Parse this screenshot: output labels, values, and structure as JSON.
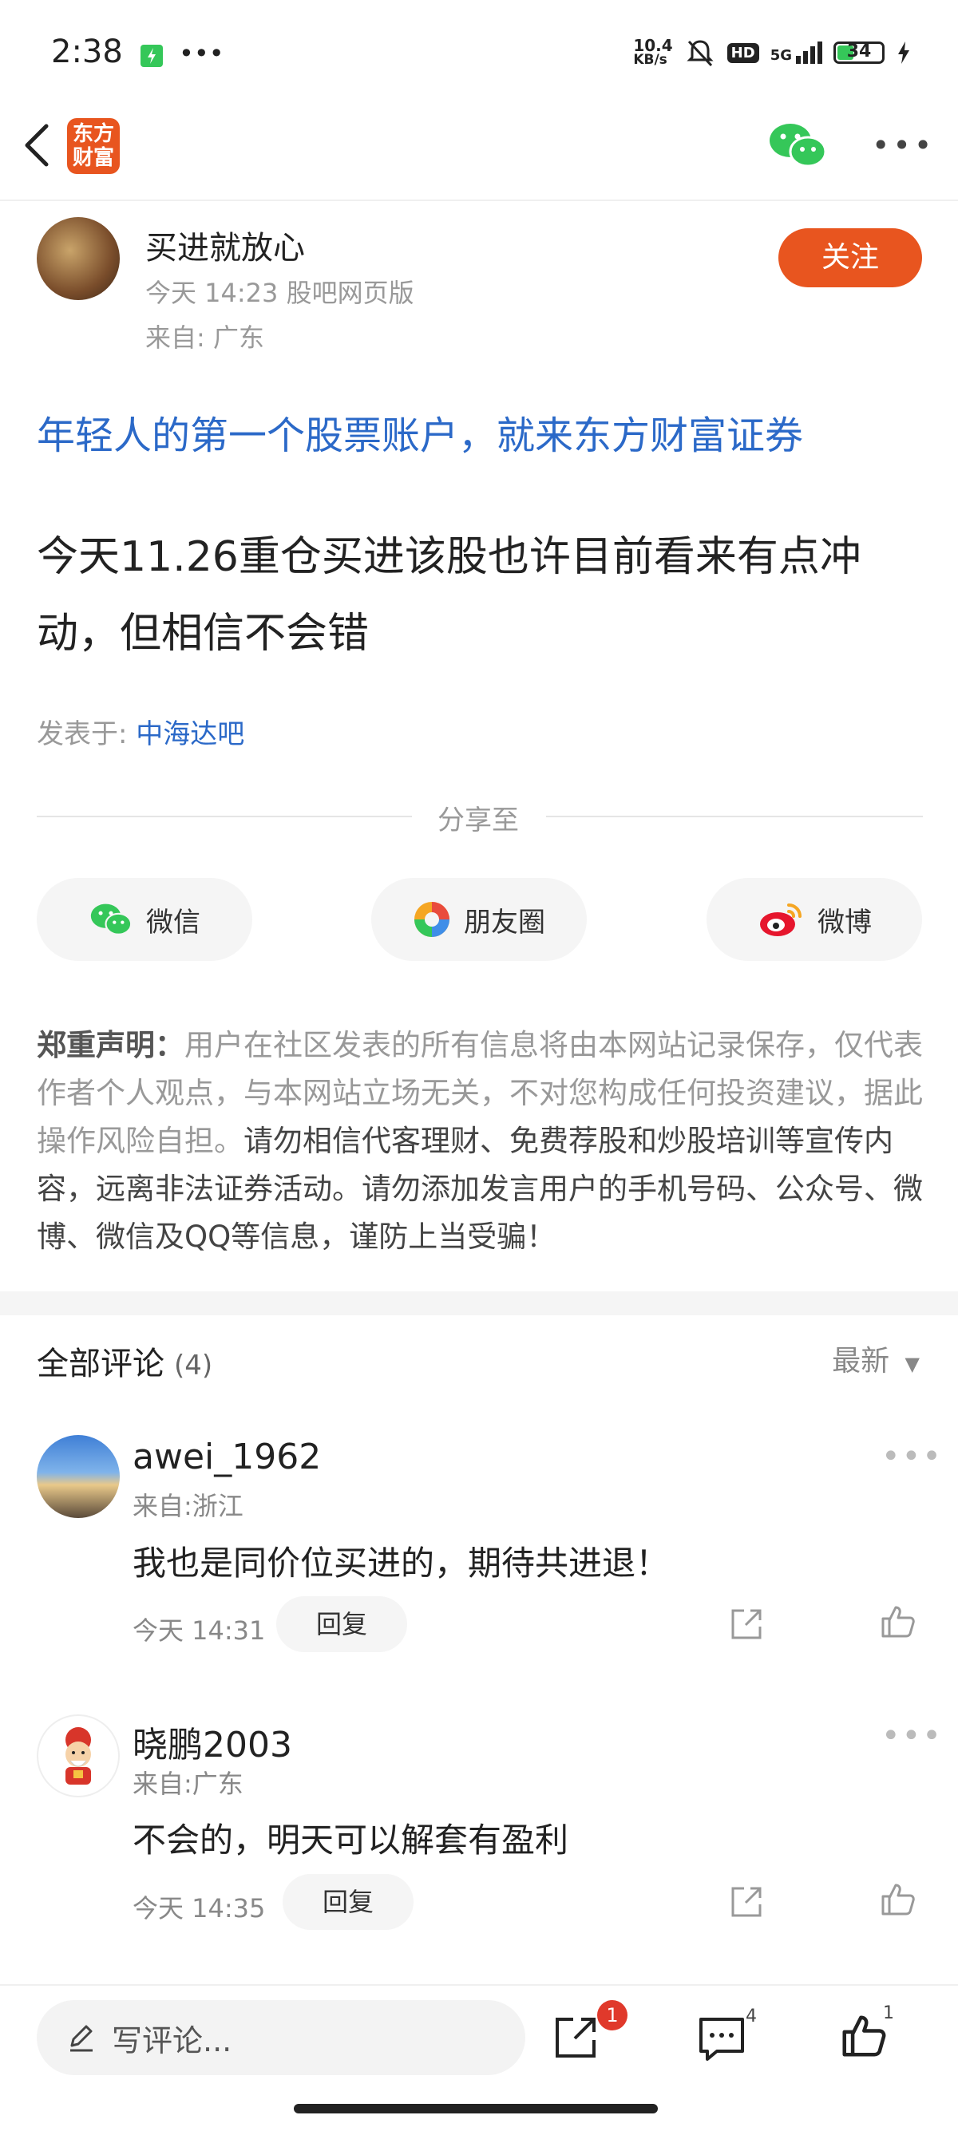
{
  "status_bar": {
    "time": "2:38",
    "net_speed_top": "10.4",
    "net_speed_bottom": "KB/s",
    "hd": "HD",
    "network": "5G",
    "battery": "34"
  },
  "header": {
    "logo_line1": "东方",
    "logo_line2": "财富"
  },
  "author": {
    "name": "买进就放心",
    "time_source": "今天 14:23 股吧网页版",
    "from": "来自: 广东",
    "follow_label": "关注"
  },
  "ad_link": "年轻人的第一个股票账户，就来东方财富证券",
  "post": {
    "content": "今天11.26重仓买进该股也许目前看来有点冲动，但相信不会错",
    "posted_in_label": "发表于:",
    "bar_name": "中海达吧"
  },
  "share": {
    "label": "分享至",
    "wechat": "微信",
    "moments": "朋友圈",
    "weibo": "微博"
  },
  "disclaimer": {
    "title": "郑重声明：",
    "body": "用户在社区发表的所有信息将由本网站记录保存，仅代表作者个人观点，与本网站立场无关，不对您构成任何投资建议，据此操作风险自担。",
    "warning": "请勿相信代客理财、免费荐股和炒股培训等宣传内容，远离非法证券活动。请勿添加发言用户的手机号码、公众号、微博、微信及QQ等信息，谨防上当受骗！"
  },
  "comments_section": {
    "title": "全部评论",
    "count": "(4)",
    "sort_label": "最新"
  },
  "comments": [
    {
      "name": "awei_1962",
      "from": "来自:浙江",
      "text": "我也是同价位买进的，期待共进退！",
      "time": "今天 14:31",
      "reply_label": "回复"
    },
    {
      "name": "晓鹏2003",
      "from": "来自:广东",
      "text": "不会的，明天可以解套有盈利",
      "time": "今天 14:35",
      "reply_label": "回复"
    }
  ],
  "bottom_bar": {
    "write_placeholder": "写评论...",
    "share_badge": "1",
    "comment_count": "4",
    "like_count": "1"
  },
  "colors": {
    "accent": "#e8551f",
    "link": "#2b69c8",
    "wechat_green": "#35c759"
  }
}
